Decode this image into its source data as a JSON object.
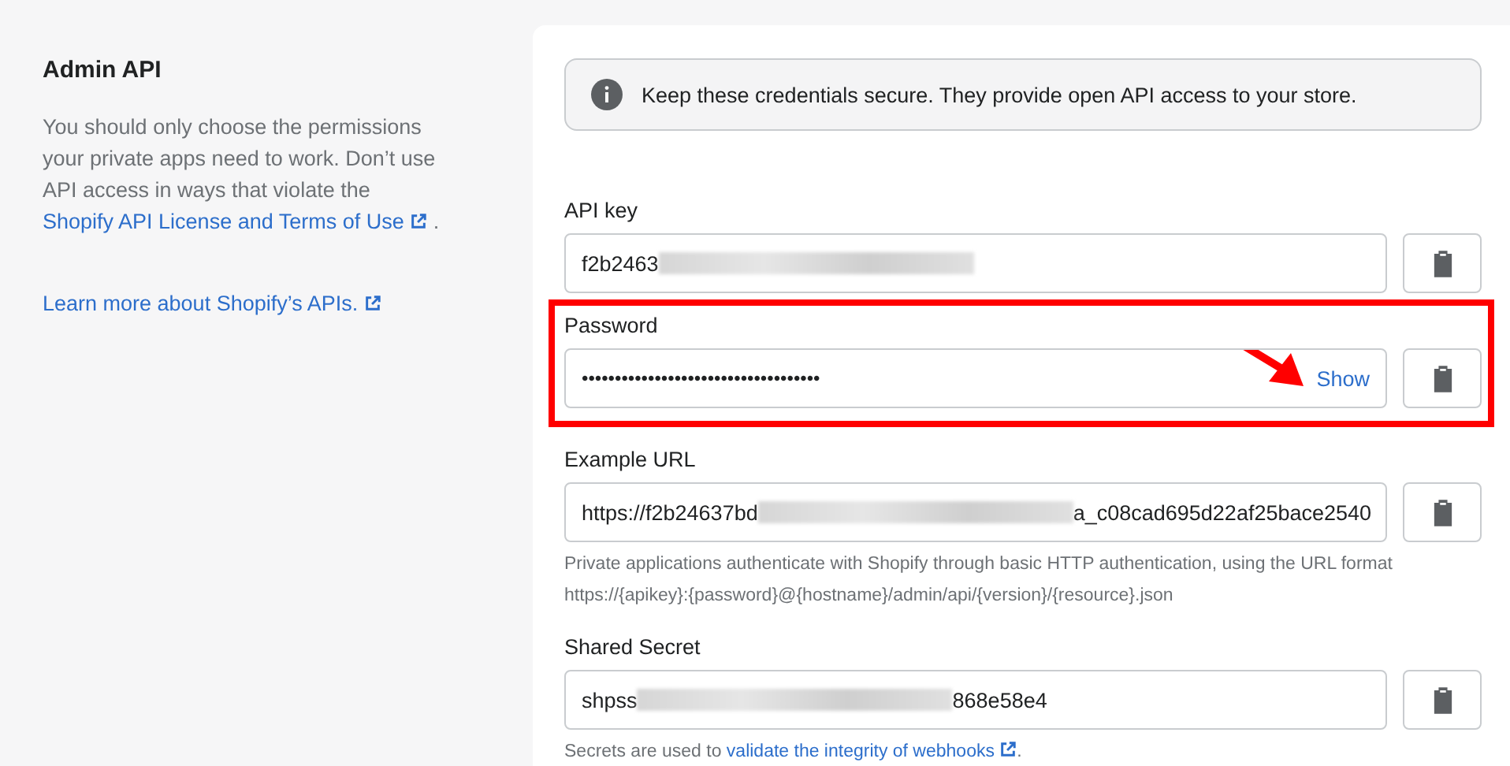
{
  "section": {
    "title": "Admin API",
    "description": {
      "text": "You should only choose the permissions your private apps need to work. Don’t use API access in ways that violate the",
      "link": "Shopify API License and Terms of Use",
      "after": "."
    },
    "learn_more": "Learn more about Shopify’s APIs."
  },
  "notice": "Keep these credentials secure. They provide open API access to your store.",
  "fields": [
    {
      "label": "API key",
      "kind": "redacted",
      "value_start": "f2b2463",
      "highlighted": false
    },
    {
      "label": "Password",
      "kind": "password",
      "value": "••••••••••••••••••••••••••••••••••••",
      "toggle": "Show",
      "highlighted": true
    },
    {
      "label": "Example URL",
      "kind": "redacted",
      "value_start": "https://f2b24637bd",
      "value_end": "a_c08cad695d22af25bace2540",
      "highlighted": false,
      "help": "Private applications authenticate with Shopify through basic HTTP authentication, using the URL format https://{apikey}:{password}@{hostname}/admin/api/{version}/{resource}.json"
    },
    {
      "label": "Shared Secret",
      "kind": "redacted",
      "value_start": "shpss",
      "value_end": "868e58e4",
      "highlighted": false,
      "help_start": "Secrets are used to",
      "help_link": "validate the integrity of webhooks",
      "help_end": "."
    }
  ]
}
